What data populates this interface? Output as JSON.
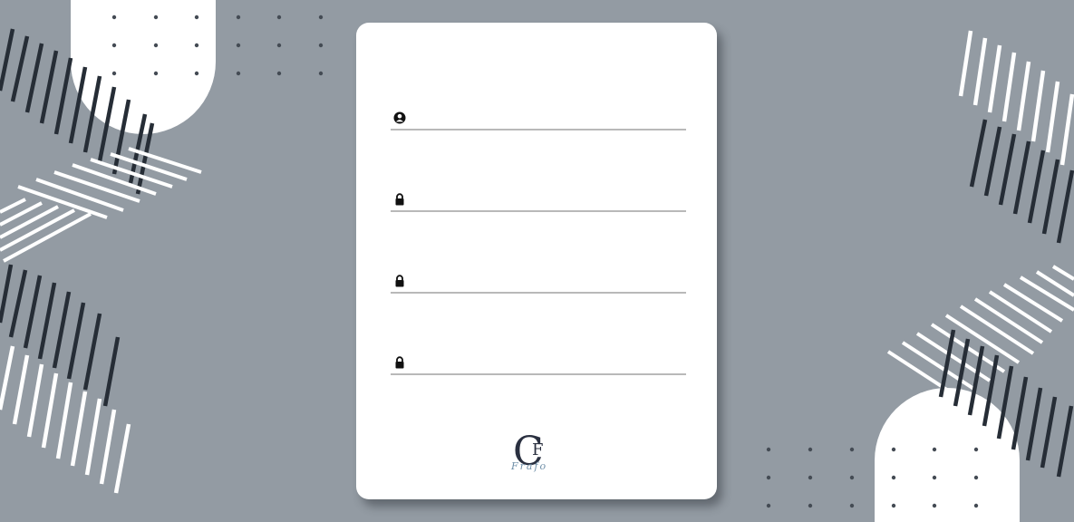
{
  "colors": {
    "background": "#939ba3",
    "card": "#ffffff",
    "stripe_light": "#ffffff",
    "stripe_dark": "#262d36",
    "underline": "#b9b9b9",
    "logo_dark": "#2a3040",
    "logo_light": "#6f8fa8"
  },
  "form": {
    "fields": [
      {
        "icon": "user-circle-icon",
        "value": "",
        "placeholder": ""
      },
      {
        "icon": "lock-icon",
        "value": "",
        "placeholder": ""
      },
      {
        "icon": "lock-icon",
        "value": "",
        "placeholder": ""
      },
      {
        "icon": "lock-icon",
        "value": "",
        "placeholder": ""
      }
    ]
  },
  "logo": {
    "initial_c": "C",
    "initial_f": "F",
    "script": "Frafo"
  }
}
